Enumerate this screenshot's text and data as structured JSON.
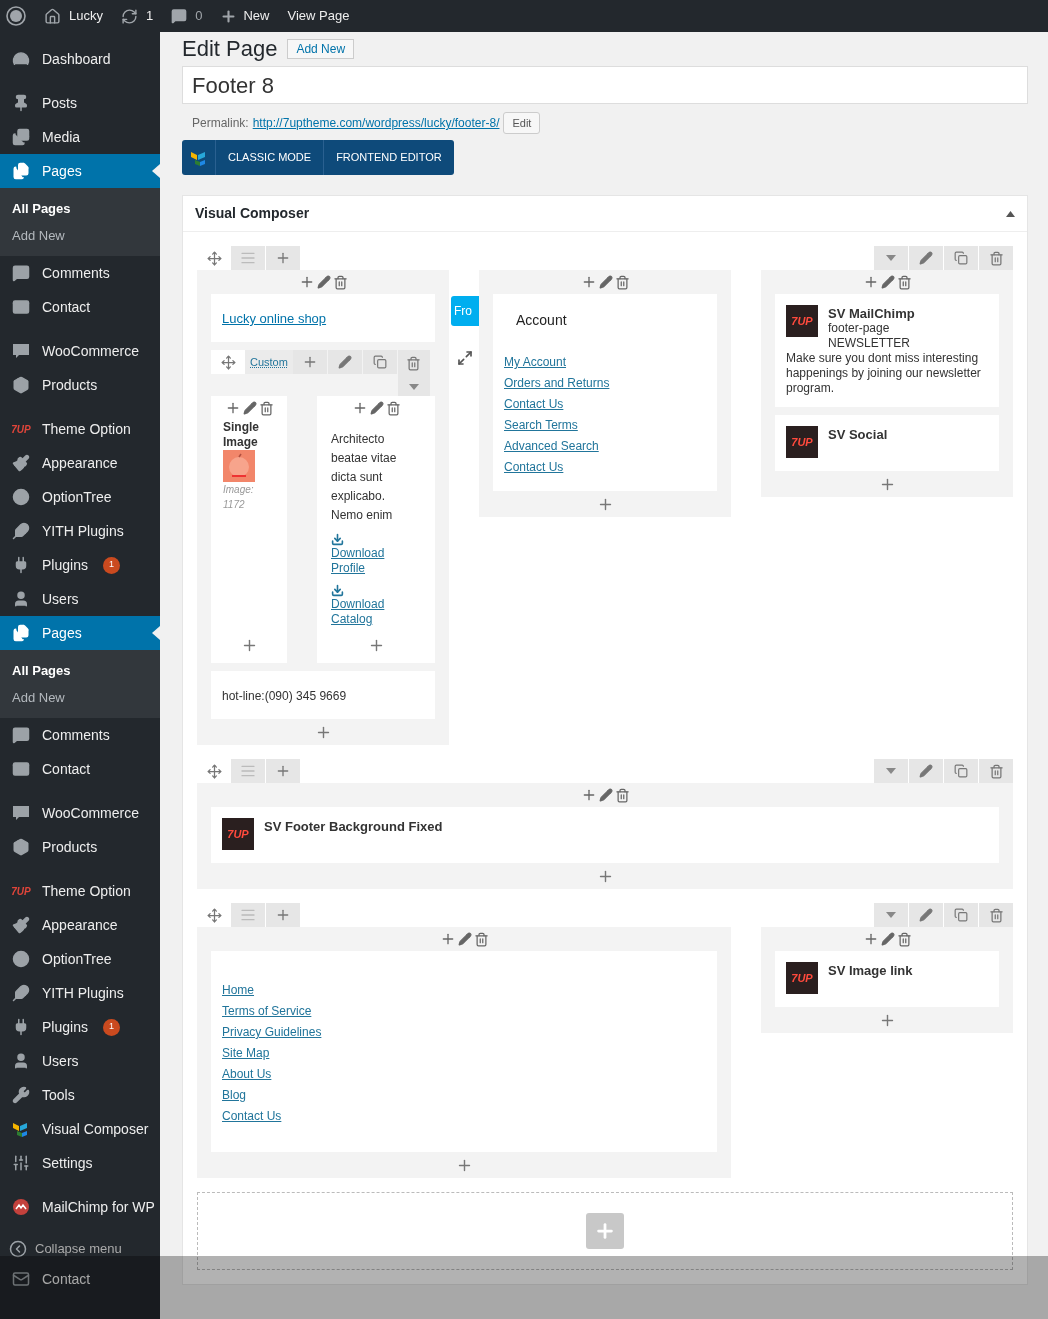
{
  "admin_bar": {
    "site": "Lucky",
    "updates": "1",
    "comments": "0",
    "new": "New",
    "view": "View Page"
  },
  "sidebar": {
    "groups": [
      [
        {
          "kind": "dashboard",
          "label": "Dashboard",
          "selected": false
        }
      ],
      [
        {
          "kind": "posts",
          "label": "Posts",
          "selected": false
        },
        {
          "kind": "media",
          "label": "Media",
          "selected": false
        },
        {
          "kind": "pages",
          "label": "Pages",
          "selected": true,
          "children": [
            {
              "label": "All Pages",
              "selected": true
            },
            {
              "label": "Add New",
              "selected": false
            }
          ]
        },
        {
          "kind": "comments",
          "label": "Comments",
          "selected": false
        },
        {
          "kind": "contact",
          "label": "Contact",
          "selected": false
        }
      ],
      [
        {
          "kind": "woocommerce",
          "label": "WooCommerce",
          "selected": false
        },
        {
          "kind": "products",
          "label": "Products",
          "selected": false
        }
      ],
      [
        {
          "kind": "theme",
          "label": "Theme Option",
          "logo": "7UP",
          "selected": false
        },
        {
          "kind": "appearance",
          "label": "Appearance",
          "selected": false
        },
        {
          "kind": "optiontree",
          "label": "OptionTree",
          "selected": false
        },
        {
          "kind": "yith",
          "label": "YITH Plugins",
          "selected": false
        },
        {
          "kind": "plugins",
          "label": "Plugins",
          "badge": "1",
          "selected": false
        },
        {
          "kind": "users",
          "label": "Users",
          "selected": false
        },
        {
          "kind": "pages",
          "label": "Pages",
          "selected": true,
          "children": [
            {
              "label": "All Pages",
              "selected": true
            },
            {
              "label": "Add New",
              "selected": false
            }
          ]
        },
        {
          "kind": "comments",
          "label": "Comments",
          "selected": false
        },
        {
          "kind": "contact",
          "label": "Contact",
          "selected": false
        }
      ],
      [
        {
          "kind": "woocommerce",
          "label": "WooCommerce",
          "selected": false
        },
        {
          "kind": "products",
          "label": "Products",
          "selected": false
        }
      ],
      [
        {
          "kind": "theme",
          "label": "Theme Option",
          "logo": "7UP",
          "selected": false
        },
        {
          "kind": "appearance",
          "label": "Appearance",
          "selected": false
        },
        {
          "kind": "optiontree",
          "label": "OptionTree",
          "selected": false
        },
        {
          "kind": "yith",
          "label": "YITH Plugins",
          "selected": false
        },
        {
          "kind": "plugins",
          "label": "Plugins",
          "badge": "1",
          "selected": false
        },
        {
          "kind": "users",
          "label": "Users",
          "selected": false
        },
        {
          "kind": "tools",
          "label": "Tools",
          "selected": false
        },
        {
          "kind": "composer",
          "label": "Visual Composer",
          "selected": false
        },
        {
          "kind": "settings",
          "label": "Settings",
          "selected": false
        }
      ],
      [
        {
          "kind": "mailchimp",
          "label": "MailChimp for WP",
          "selected": false
        }
      ]
    ],
    "collapse": "Collapse menu",
    "trailing": "Contact"
  },
  "page": {
    "heading": "Edit Page",
    "add_new": "Add New",
    "title_value": "Footer 8",
    "permalink_label": "Permalink:",
    "permalink_url": "http://7uptheme.com/wordpress/lucky/footer-8/",
    "edit_button": "Edit",
    "mode_buttons": [
      "CLASSIC MODE",
      "FRONTEND EDITOR"
    ]
  },
  "composer": {
    "title": "Visual Composer",
    "expanded": true,
    "rows": [
      {
        "overlay_button": "Fro",
        "columns": [
          {
            "kind": "third",
            "elements": [
              {
                "kind": "link_text",
                "text": "Lucky online shop"
              },
              {
                "kind": "inner_row",
                "label": "Custom",
                "columns": [
                  {
                    "kind": "narrow",
                    "elements": [
                      {
                        "kind": "single_image",
                        "title": "Single Image",
                        "caption": "Image: 1172"
                      }
                    ]
                  },
                  {
                    "kind": "wide",
                    "elements": [
                      {
                        "kind": "text_block",
                        "paragraph": "Architecto beatae vitae dicta sunt explicabo. Nemo enim",
                        "downloads": [
                          "Download Profile",
                          "Download Catalog"
                        ]
                      }
                    ]
                  }
                ]
              },
              {
                "kind": "plain_text",
                "text": "hot-line:(090) 345 9669"
              }
            ]
          },
          {
            "kind": "third",
            "elements": [
              {
                "kind": "link_list",
                "title": "Account",
                "links": [
                  "My Account",
                  "Orders and Returns",
                  "Contact Us",
                  "Search Terms",
                  "Advanced Search",
                  "Contact Us"
                ]
              }
            ]
          },
          {
            "kind": "third",
            "elements": [
              {
                "kind": "widget",
                "logo": "7UP",
                "title": "SV MailChimp",
                "lines": [
                  "footer-page",
                  "NEWSLETTER"
                ],
                "description": "Make sure you dont miss interesting happenings by joining our newsletter program."
              },
              {
                "kind": "widget",
                "logo": "7UP",
                "title": "SV Social"
              }
            ]
          }
        ]
      },
      {
        "columns": [
          {
            "kind": "full",
            "elements": [
              {
                "kind": "widget",
                "logo": "7UP",
                "title": "SV Footer Background Fixed"
              }
            ]
          }
        ]
      },
      {
        "columns": [
          {
            "kind": "two_thirds",
            "elements": [
              {
                "kind": "link_list",
                "links": [
                  "Home",
                  "Terms of Service",
                  "Privacy Guidelines",
                  "Site Map",
                  "About Us",
                  "Blog",
                  "Contact Us"
                ]
              }
            ]
          },
          {
            "kind": "third",
            "elements": [
              {
                "kind": "widget",
                "logo": "7UP",
                "title": "SV Image link"
              }
            ]
          }
        ]
      }
    ]
  }
}
